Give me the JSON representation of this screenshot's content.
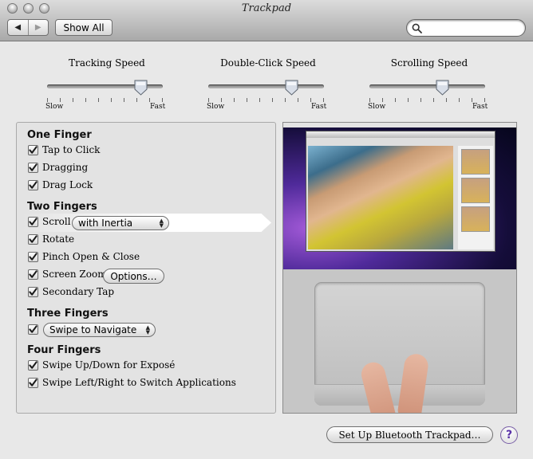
{
  "window": {
    "title": "Trackpad"
  },
  "toolbar": {
    "back_glyph": "◀",
    "forward_glyph": "▶",
    "show_all_label": "Show All",
    "search_placeholder": ""
  },
  "sliders": [
    {
      "label": "Tracking Speed",
      "min_label": "Slow",
      "max_label": "Fast",
      "value": 0.85
    },
    {
      "label": "Double-Click Speed",
      "min_label": "Slow",
      "max_label": "Fast",
      "value": 0.75
    },
    {
      "label": "Scrolling Speed",
      "min_label": "Slow",
      "max_label": "Fast",
      "value": 0.65
    }
  ],
  "sections": {
    "one_finger": {
      "title": "One Finger",
      "options": [
        {
          "label": "Tap to Click",
          "checked": true
        },
        {
          "label": "Dragging",
          "checked": true
        },
        {
          "label": "Drag Lock",
          "checked": true
        }
      ]
    },
    "two_fingers": {
      "title": "Two Fingers",
      "scroll_label": "Scroll",
      "scroll_popup": "with Inertia",
      "rotate_label": "Rotate",
      "pinch_label": "Pinch Open & Close",
      "zoom_label": "Screen Zoom",
      "zoom_options_button": "Options…",
      "secondary_tap_label": "Secondary Tap"
    },
    "three_fingers": {
      "title": "Three Fingers",
      "popup": "Swipe to Navigate"
    },
    "four_fingers": {
      "title": "Four Fingers",
      "options": [
        {
          "label": "Swipe Up/Down for Exposé",
          "checked": true
        },
        {
          "label": "Swipe Left/Right to Switch Applications",
          "checked": true
        }
      ]
    }
  },
  "footer": {
    "bluetooth_button": "Set Up Bluetooth Trackpad…",
    "help_glyph": "?"
  },
  "colors": {
    "accent_purple": "#5a32a8",
    "checkmark": "#1a1a1a"
  },
  "icons": {
    "search": "magnifier-icon",
    "help": "question-mark-icon"
  }
}
